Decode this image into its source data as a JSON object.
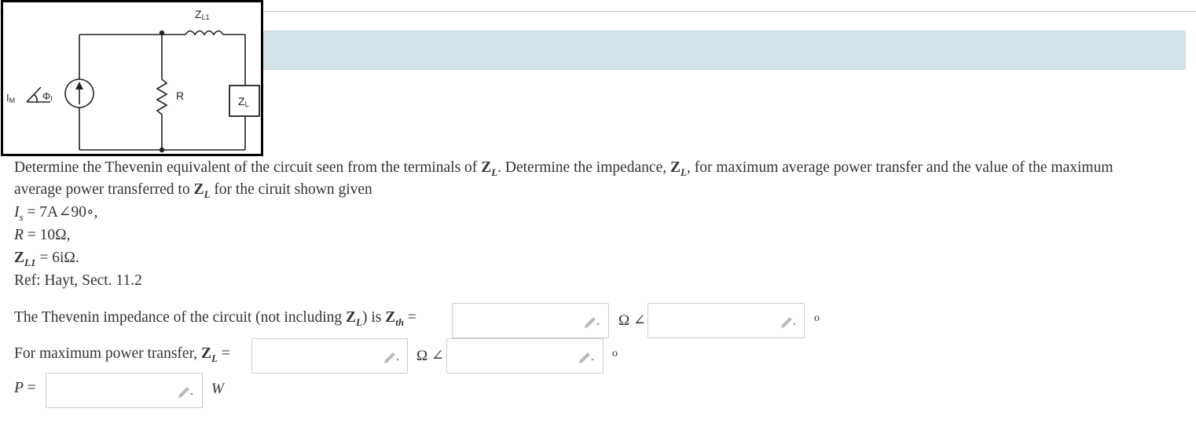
{
  "diagram": {
    "zl1_label": "Z",
    "zl1_sub": "L1",
    "r_label": "R",
    "zl_label": "Z",
    "zl_sub": "L",
    "source_mag": "I",
    "source_mag_sub": "M",
    "source_phase": "Φ",
    "source_phase_sub": "I"
  },
  "problem": {
    "text_1": "Determine the Thevenin equivalent of the circuit seen from the terminals of ",
    "zl_bold": "Z",
    "zl_sub": "L",
    "text_2": ". Determine the impedance, ",
    "text_3": ", for maximum average power transfer and the value of the maximum",
    "text_4": "average power transferred to ",
    "text_5": " for the ciruit shown given",
    "is_line": "I",
    "is_sub": "s",
    "is_value": " = 7A∠90∘,",
    "r_line": "R",
    "r_value": " = 10Ω,",
    "zl1_line": "Z",
    "zl1_sub": "L1",
    "zl1_value": " = 6iΩ.",
    "ref": "Ref: Hayt, Sect. 11.2"
  },
  "questions": {
    "q1_text": "The Thevenin impedance of the circuit (not including ",
    "q1_zl": "Z",
    "q1_zl_sub": "L",
    "q1_mid": ") is ",
    "q1_zth": "Z",
    "q1_zth_sub": "th",
    "q1_eq": " =",
    "q2_text": "For maximum power transfer, ",
    "q2_zl": "Z",
    "q2_zl_sub": "L",
    "q2_eq": " =",
    "q3_p": "P",
    "q3_eq": " =",
    "ohm_angle": "Ω ∠",
    "deg_symbol": "o",
    "watt_unit": "W"
  },
  "inputs": {
    "zth_mag": "",
    "zth_angle": "",
    "zl_mag": "",
    "zl_angle": "",
    "power": ""
  }
}
